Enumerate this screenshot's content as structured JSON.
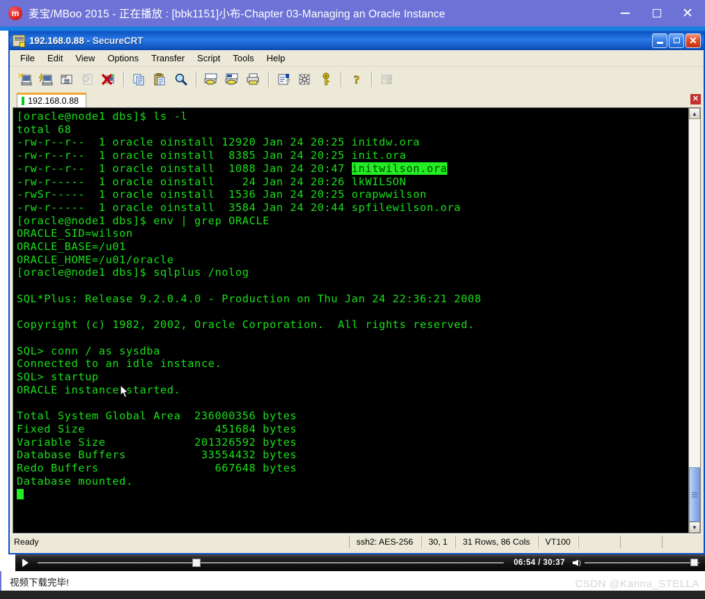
{
  "player": {
    "logo_glyph": "m",
    "title": "麦宝/MBoo 2015 - 正在播放 : [bbk1151]小布-Chapter 03-Managing an Oracle Instance",
    "minimize_label": "",
    "maximize_label": "",
    "close_label": "✕"
  },
  "crt": {
    "title_host": "192.168.0.88",
    "title_suffix": " - SecureCRT",
    "menus": [
      "File",
      "Edit",
      "View",
      "Options",
      "Transfer",
      "Script",
      "Tools",
      "Help"
    ],
    "toolbar_icons": [
      "connect-icon",
      "quick-connect-icon",
      "connect-in-tab-icon",
      "clone-session-icon",
      "disconnect-icon",
      "copy-icon",
      "paste-icon",
      "find-icon",
      "print-icon",
      "print-selection-icon",
      "print-screen-icon",
      "session-options-icon",
      "global-options-icon",
      "key-icon",
      "help-icon",
      "lock-icon"
    ],
    "tab": {
      "label": "192.168.0.88",
      "close_label": "✕"
    },
    "status": {
      "ready": "Ready",
      "protocol": "ssh2: AES-256",
      "cursor_pos": "30,  1",
      "dimensions": "31 Rows, 86 Cols",
      "emulation": "VT100"
    },
    "scrollbar": {
      "up_arrow": "▲",
      "down_arrow": "▼"
    }
  },
  "terminal": {
    "lines": [
      {
        "text": "[oracle@node1 dbs]$ ls -l"
      },
      {
        "text": "total 68"
      },
      {
        "text": "-rw-r--r--  1 oracle oinstall 12920 Jan 24 20:25 initdw.ora"
      },
      {
        "text": "-rw-r--r--  1 oracle oinstall  8385 Jan 24 20:25 init.ora"
      },
      {
        "pre": "-rw-r--r--  1 oracle oinstall  1088 Jan 24 20:47 ",
        "highlight": "initwilson.ora"
      },
      {
        "text": "-rw-r-----  1 oracle oinstall    24 Jan 24 20:26 lkWILSON"
      },
      {
        "text": "-rwSr-----  1 oracle oinstall  1536 Jan 24 20:25 orapwwilson"
      },
      {
        "text": "-rw-r-----  1 oracle oinstall  3584 Jan 24 20:44 spfilewilson.ora"
      },
      {
        "text": "[oracle@node1 dbs]$ env | grep ORACLE"
      },
      {
        "text": "ORACLE_SID=wilson"
      },
      {
        "text": "ORACLE_BASE=/u01"
      },
      {
        "text": "ORACLE_HOME=/u01/oracle"
      },
      {
        "text": "[oracle@node1 dbs]$ sqlplus /nolog"
      },
      {
        "text": ""
      },
      {
        "text": "SQL*Plus: Release 9.2.0.4.0 - Production on Thu Jan 24 22:36:21 2008"
      },
      {
        "text": ""
      },
      {
        "text": "Copyright (c) 1982, 2002, Oracle Corporation.  All rights reserved."
      },
      {
        "text": ""
      },
      {
        "text": "SQL> conn / as sysdba"
      },
      {
        "text": "Connected to an idle instance."
      },
      {
        "text": "SQL> startup"
      },
      {
        "text": "ORACLE instance started."
      },
      {
        "text": ""
      },
      {
        "text": "Total System Global Area  236000356 bytes"
      },
      {
        "text": "Fixed Size                   451684 bytes"
      },
      {
        "text": "Variable Size             201326592 bytes"
      },
      {
        "text": "Database Buffers           33554432 bytes"
      },
      {
        "text": "Redo Buffers                 667648 bytes"
      },
      {
        "text": "Database mounted."
      }
    ]
  },
  "media": {
    "play_label": "",
    "time_display": "06:54 / 30:37",
    "seek_percent": 34,
    "volume_percent": 98
  },
  "footer": {
    "note": "视频下载完毕!",
    "watermark": "CSDN @Kanna_STELLA"
  },
  "colors": {
    "player_titlebar": "#6d72d6",
    "crt_titlebar": "#0d56c4",
    "terminal_bg": "#000000",
    "terminal_fg": "#19e019",
    "highlight_bg": "#22ee22",
    "chrome_bg": "#ece9d8"
  }
}
